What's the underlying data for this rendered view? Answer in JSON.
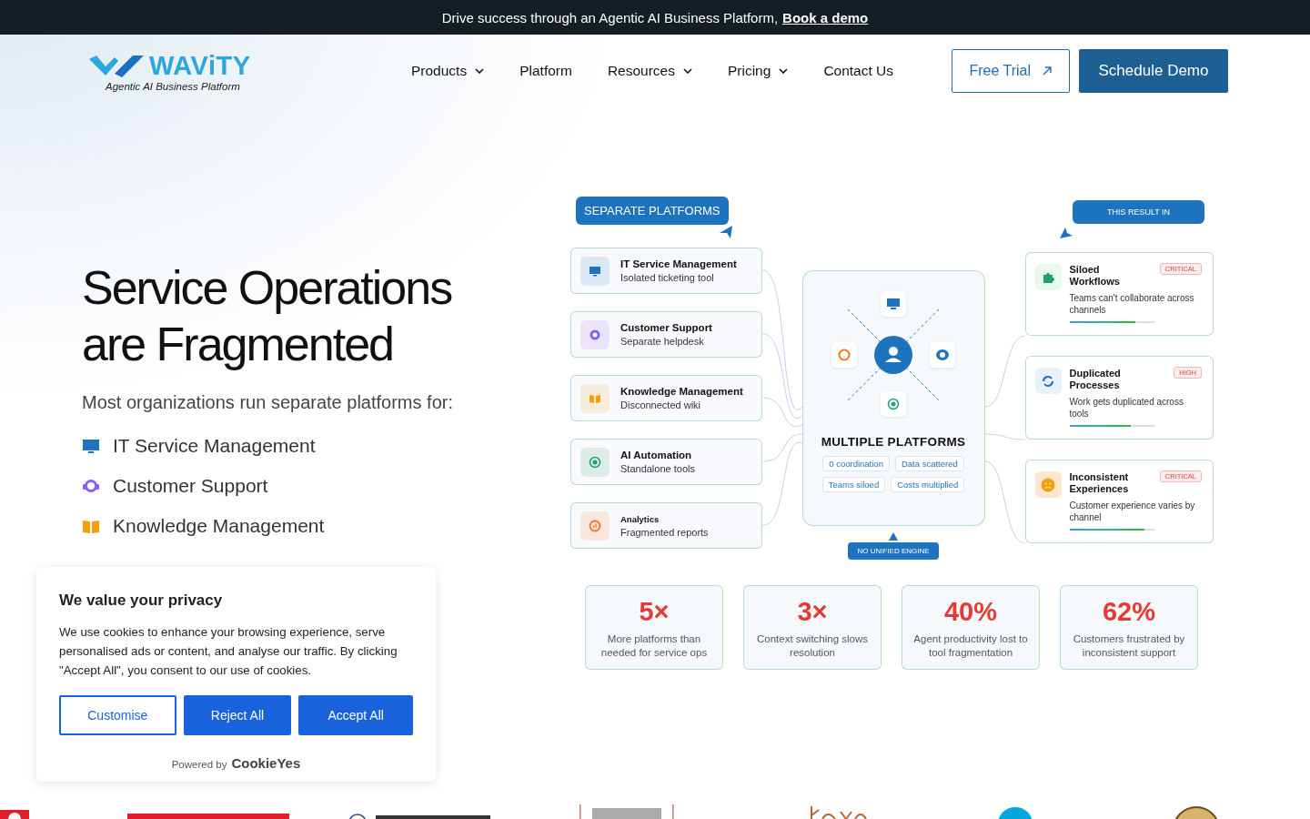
{
  "announcement": {
    "text": "Drive success through an Agentic AI Business Platform,",
    "link": "Book a demo"
  },
  "logo": {
    "name": "WAViTY",
    "tagline": "Agentic AI Business Platform"
  },
  "nav": [
    {
      "label": "Products",
      "has_menu": true
    },
    {
      "label": "Platform",
      "has_menu": false
    },
    {
      "label": "Resources",
      "has_menu": true
    },
    {
      "label": "Pricing",
      "has_menu": true
    },
    {
      "label": "Contact Us",
      "has_menu": false
    }
  ],
  "actions": [
    {
      "label": "Free Trial",
      "kind": "outline"
    },
    {
      "label": "Schedule Demo",
      "kind": "solid"
    }
  ],
  "hero": {
    "title_lines": [
      "Service Operations",
      "are Fragmented"
    ],
    "subtitle": "Most organizations run separate platforms for:",
    "items": [
      {
        "label": "IT Service Management",
        "color": "#1e73be"
      },
      {
        "label": "Customer Support",
        "color": "#8b5cf6"
      },
      {
        "label": "Knowledge Management",
        "color": "#f59e0b"
      }
    ]
  },
  "diagram": {
    "left_tag": "SEPARATE PLATFORMS",
    "right_tag": "THIS RESULT IN",
    "platforms": [
      {
        "title": "IT Service Management",
        "subtitle": "Isolated ticketing tool",
        "color": "#1e73be"
      },
      {
        "title": "Customer Support",
        "subtitle": "Separate helpdesk",
        "color": "#8b5cf6"
      },
      {
        "title": "Knowledge Management",
        "subtitle": "Disconnected wiki",
        "color": "#f59e0b"
      },
      {
        "title": "AI Automation",
        "subtitle": "Standalone tools",
        "color": "#22a06b"
      },
      {
        "title": "Analytics",
        "subtitle": "Fragmented reports",
        "color": "#f97316"
      }
    ],
    "center": {
      "title": "MULTIPLE PLATFORMS",
      "chips": [
        "0 coordination",
        "Data scattered",
        "Teams siloed",
        "Costs multiplied"
      ],
      "footer": "NO UNIFIED ENGINE"
    },
    "results": [
      {
        "title": "Siloed Workflows",
        "text": "Teams can't collaborate across channels",
        "severity": "CRITICAL",
        "level": 0.78
      },
      {
        "title": "Duplicated Processes",
        "text": "Work gets duplicated across tools",
        "severity": "HIGH",
        "level": 0.73
      },
      {
        "title": "Inconsistent Experiences",
        "text": "Customer experience varies by channel",
        "severity": "CRITICAL",
        "level": 0.89
      }
    ],
    "stats": [
      {
        "value": "5×",
        "text": "More platforms than needed for service ops"
      },
      {
        "value": "3×",
        "text": "Context switching slows resolution"
      },
      {
        "value": "40%",
        "text": "Agent productivity lost to tool fragmentation"
      },
      {
        "value": "62%",
        "text": "Customers frustrated by inconsistent support"
      }
    ]
  },
  "cookie_dialog": {
    "title": "We value your privacy",
    "text": "We use cookies to enhance your browsing experience, serve personalised ads or content, and analyse our traffic. By clicking \"Accept All\", you consent to our use of cookies.",
    "buttons": [
      {
        "label": "Customise",
        "kind": "outline"
      },
      {
        "label": "Reject All",
        "kind": "solid"
      },
      {
        "label": "Accept All",
        "kind": "solid"
      }
    ],
    "powered_by": "Powered by",
    "brand": "CookieYes"
  }
}
